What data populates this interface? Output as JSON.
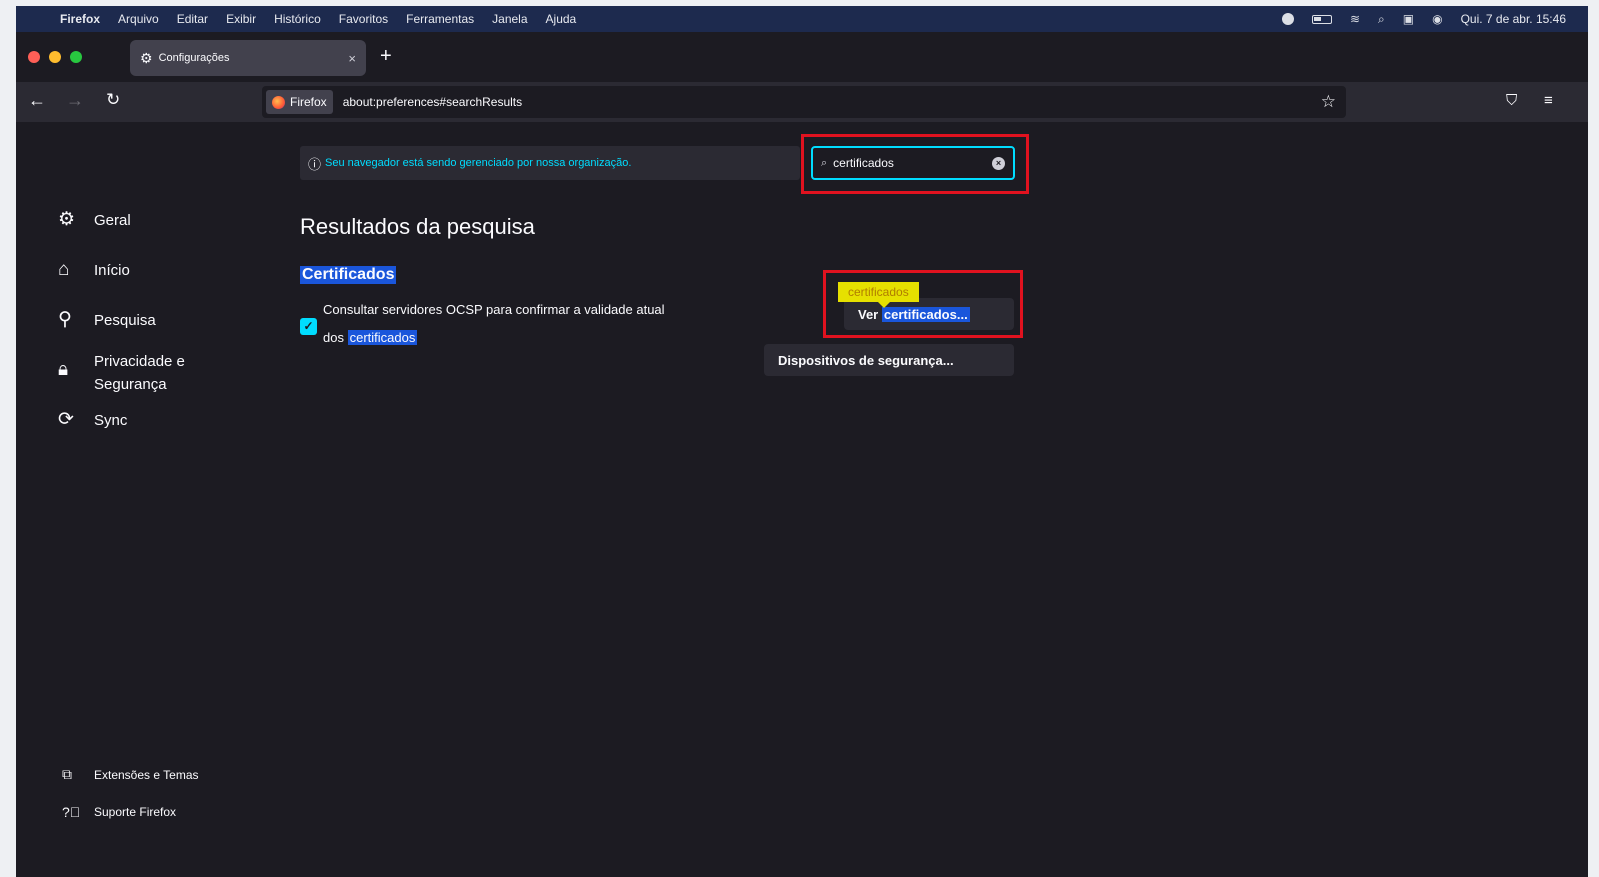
{
  "menubar": {
    "app_name": "Firefox",
    "items": [
      "Arquivo",
      "Editar",
      "Exibir",
      "Histórico",
      "Favoritos",
      "Ferramentas",
      "Janela",
      "Ajuda"
    ],
    "clock": "Qui. 7 de abr. 15:46"
  },
  "tab": {
    "title": "Configurações",
    "close": "×"
  },
  "navbar": {
    "identity_label": "Firefox",
    "url": "about:preferences#searchResults"
  },
  "banner": {
    "text": "Seu navegador está sendo gerenciado por nossa organização."
  },
  "search": {
    "value": "certificados"
  },
  "sidebar": {
    "items": [
      {
        "label": "Geral"
      },
      {
        "label": "Início"
      },
      {
        "label": "Pesquisa"
      },
      {
        "label": "Privacidade e Segurança"
      },
      {
        "label": "Sync"
      }
    ],
    "bottom": [
      {
        "label": "Extensões e Temas"
      },
      {
        "label": "Suporte Firefox"
      }
    ]
  },
  "main": {
    "title": "Resultados da pesquisa",
    "section_heading": "Certificados",
    "ocsp_line1": "Consultar servidores OCSP para confirmar a validade atual",
    "ocsp_prefix": "dos",
    "ocsp_highlight": "certificados",
    "tooltip": "certificados",
    "view_prefix": "Ver",
    "view_highlight": "certificados...",
    "security_devices": "Dispositivos de segurança..."
  },
  "colors": {
    "accent": "#00ddff",
    "highlight": "#1a56db",
    "annotation": "#e0121f",
    "tooltip": "#e6e000"
  }
}
